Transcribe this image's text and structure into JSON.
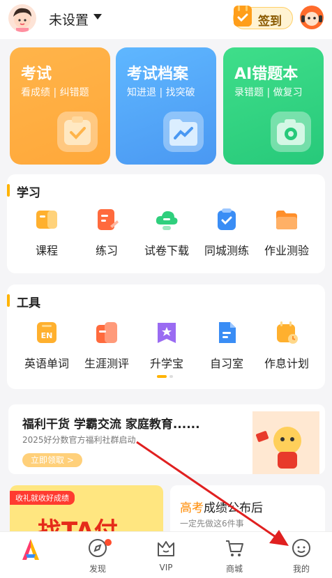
{
  "header": {
    "user_name": "未设置",
    "signin_label": "签到"
  },
  "cards": [
    {
      "title": "考试",
      "subtitle": "看成绩 | 纠错题"
    },
    {
      "title": "考试档案",
      "subtitle": "知进退 | 找突破"
    },
    {
      "title": "AI错题本",
      "subtitle": "录错题 | 做复习"
    }
  ],
  "learn": {
    "title": "学习",
    "items": [
      {
        "label": "课程",
        "color": "#ffb02e"
      },
      {
        "label": "练习",
        "color": "#ff6a3d"
      },
      {
        "label": "试卷下载",
        "color": "#2fcf7d"
      },
      {
        "label": "同城测练",
        "color": "#3a8df5"
      },
      {
        "label": "作业测验",
        "color": "#ff8f2a"
      }
    ]
  },
  "tools": {
    "title": "工具",
    "items": [
      {
        "label": "英语单词",
        "color": "#ffb02e"
      },
      {
        "label": "生涯测评",
        "color": "#ff6a3d"
      },
      {
        "label": "升学宝",
        "color": "#9a6bf2"
      },
      {
        "label": "自习室",
        "color": "#3a8df5"
      },
      {
        "label": "作息计划",
        "color": "#ffb02e"
      }
    ]
  },
  "banner": {
    "title": "福利干货 学霸交流 家庭教育......",
    "subtitle": "2025好分数官方福利社群启动",
    "button": "立即领取 >"
  },
  "promo_left": {
    "tag": "收礼就收好成绩",
    "big_text": "找TA付"
  },
  "promo_right": {
    "title_highlight": "高考",
    "title_rest": "成绩公布后",
    "subtitle": "一定先做这6件事"
  },
  "tabbar": [
    {
      "label": ""
    },
    {
      "label": "发现"
    },
    {
      "label": "VIP"
    },
    {
      "label": "商城"
    },
    {
      "label": "我的"
    }
  ],
  "colors": {
    "accent": "#ffb300",
    "annotation_arrow": "#e02020"
  }
}
